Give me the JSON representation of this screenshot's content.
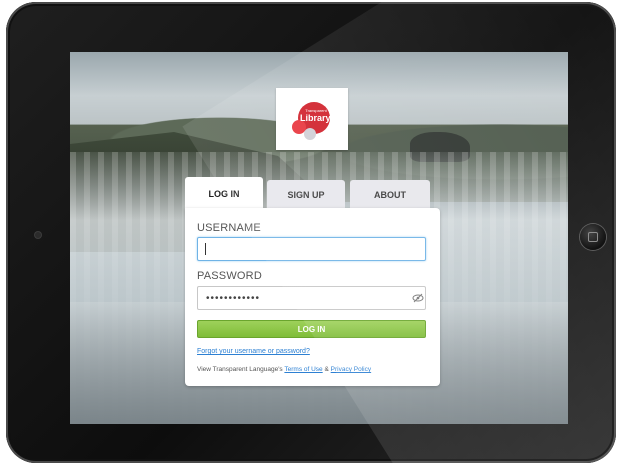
{
  "logo": {
    "small_text": "Transparent",
    "text": "Library"
  },
  "tabs": [
    {
      "label": "LOG IN",
      "active": true
    },
    {
      "label": "SIGN UP",
      "active": false
    },
    {
      "label": "ABOUT",
      "active": false
    }
  ],
  "form": {
    "username_label": "USERNAME",
    "username_value": "",
    "password_label": "PASSWORD",
    "password_value": "••••••••••••",
    "login_button": "LOG IN",
    "forgot_link": "Forgot your username or password?",
    "terms_prefix": "View Transparent Language's",
    "terms_link": "Terms of Use",
    "terms_amp": "&",
    "privacy_link": "Privacy Policy"
  },
  "colors": {
    "accent_green": "#8cc63f",
    "link_blue": "#2d80d3",
    "logo_red": "#d0202a"
  },
  "icons": {
    "password_toggle": "eye-slash-icon",
    "home_button": "home-button-icon",
    "camera": "camera-icon"
  }
}
